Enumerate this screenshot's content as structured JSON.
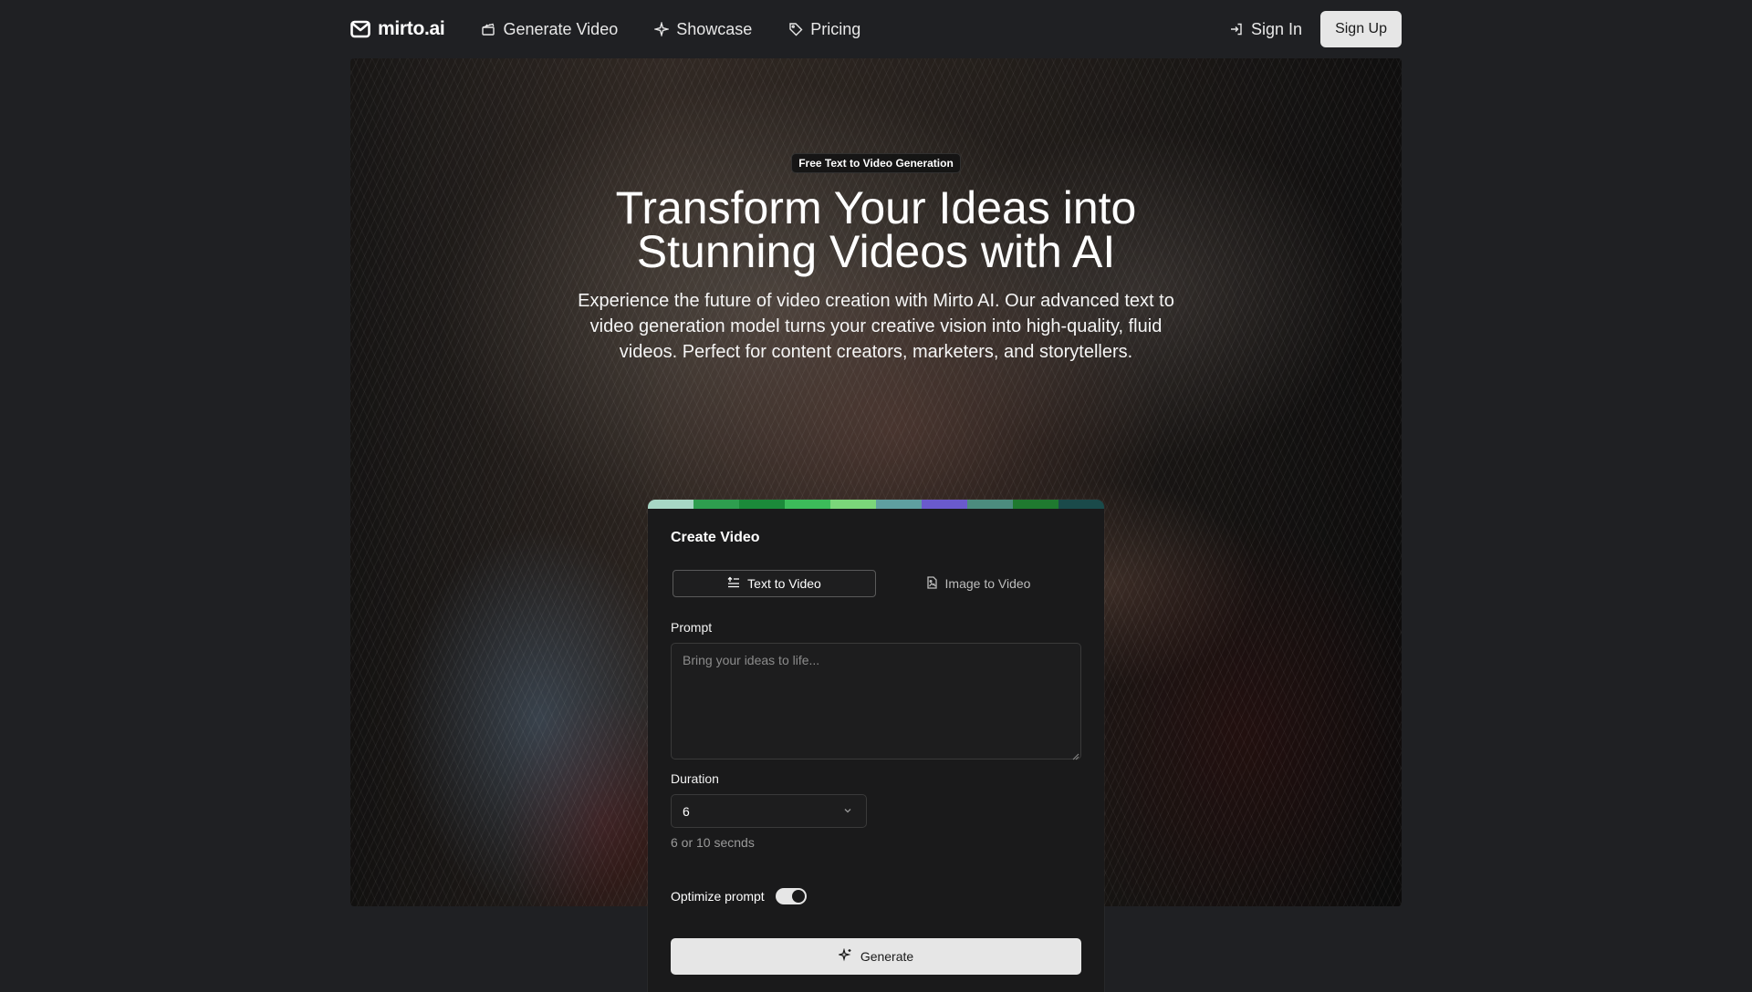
{
  "nav": {
    "logo_text": "mirto.ai",
    "links": [
      {
        "label": "Generate Video",
        "icon": "clapperboard-icon"
      },
      {
        "label": "Showcase",
        "icon": "sparkle-icon"
      },
      {
        "label": "Pricing",
        "icon": "tag-icon"
      }
    ],
    "sign_in": "Sign In",
    "sign_up": "Sign Up"
  },
  "hero": {
    "badge": "Free Text to Video Generation",
    "title": "Transform Your Ideas into Stunning Videos with AI",
    "subtitle": "Experience the future of video creation with Mirto AI. Our advanced text to video generation model turns your creative vision into high-quality, fluid videos. Perfect for content creators, marketers, and storytellers."
  },
  "card": {
    "title": "Create Video",
    "stripe_colors": [
      "#a7d7c5",
      "#2e9e4f",
      "#1b8a3a",
      "#3cbc5a",
      "#7bd67a",
      "#5f9fa0",
      "#6a5acd",
      "#4c8c7e",
      "#1f7a2f",
      "#1a4a4a"
    ],
    "tabs": [
      {
        "label": "Text to Video",
        "icon": "text-lines-icon",
        "active": true
      },
      {
        "label": "Image to Video",
        "icon": "image-file-icon",
        "active": false
      }
    ],
    "prompt_label": "Prompt",
    "prompt_value": "",
    "prompt_placeholder": "Bring your ideas to life...",
    "duration_label": "Duration",
    "duration_value": "6",
    "duration_hint": "6 or 10 secnds",
    "optimize_label": "Optimize prompt",
    "optimize_enabled": true,
    "generate_label": "Generate"
  },
  "colors": {
    "page_bg": "#1f2023",
    "card_bg": "#1a1a1b",
    "button_light": "#e6e6e6"
  }
}
